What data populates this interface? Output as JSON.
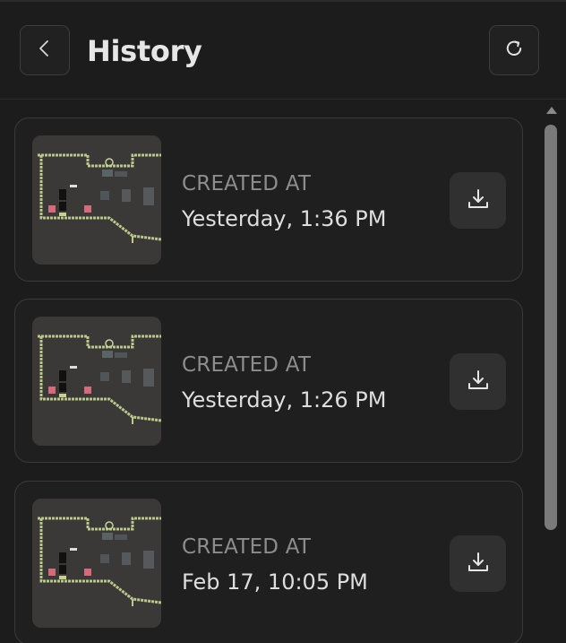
{
  "header": {
    "title": "History",
    "back_icon": "chevron-left-icon",
    "refresh_icon": "refresh-icon"
  },
  "history": {
    "items": [
      {
        "label": "CREATED AT",
        "value": "Yesterday, 1:36 PM",
        "download_icon": "download-icon"
      },
      {
        "label": "CREATED AT",
        "value": "Yesterday, 1:26 PM",
        "download_icon": "download-icon"
      },
      {
        "label": "CREATED AT",
        "value": "Feb 17, 10:05 PM",
        "download_icon": "download-icon"
      }
    ]
  },
  "colors": {
    "background": "#1c1c1c",
    "card_border": "#3a3a3a",
    "title_text": "#e6e6e6",
    "label_text": "#8d8d8d",
    "value_text": "#dedede",
    "thumbnail_wall": "#b8c98a"
  }
}
